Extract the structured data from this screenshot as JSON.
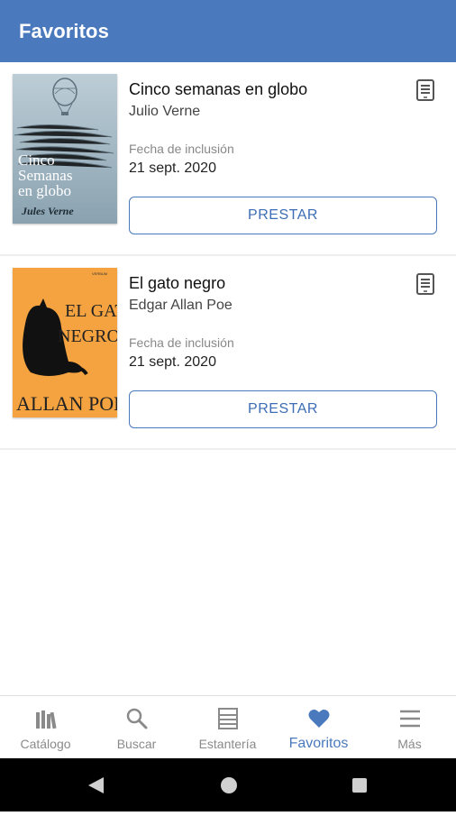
{
  "appbar": {
    "title": "Favoritos"
  },
  "books": [
    {
      "title": "Cinco semanas en globo",
      "author": "Julio Verne",
      "inclusion_label": "Fecha de inclusión",
      "inclusion_date": "21 sept. 2020",
      "button_label": "PRESTAR",
      "format_icon": "ebook-icon"
    },
    {
      "title": "El gato negro",
      "author": "Edgar Allan Poe",
      "inclusion_label": "Fecha de inclusión",
      "inclusion_date": "21 sept. 2020",
      "button_label": "PRESTAR",
      "format_icon": "ebook-icon"
    }
  ],
  "covers": [
    {
      "lines": [
        "Cinco",
        "Semanas",
        "en globo"
      ],
      "author": "Jules Verne"
    },
    {
      "lines": [
        "EL GATO",
        "NEGRO"
      ],
      "author": "ALLAN POE",
      "publisher": "VERBUM"
    }
  ],
  "bottom_nav": {
    "items": [
      {
        "label": "Catálogo",
        "icon": "books-icon"
      },
      {
        "label": "Buscar",
        "icon": "search-icon"
      },
      {
        "label": "Estantería",
        "icon": "shelf-icon"
      },
      {
        "label": "Favoritos",
        "icon": "heart-icon"
      },
      {
        "label": "Más",
        "icon": "menu-icon"
      }
    ],
    "active": "Favoritos"
  },
  "colors": {
    "primary": "#4a79bd",
    "inactive": "#8a8a8a"
  }
}
